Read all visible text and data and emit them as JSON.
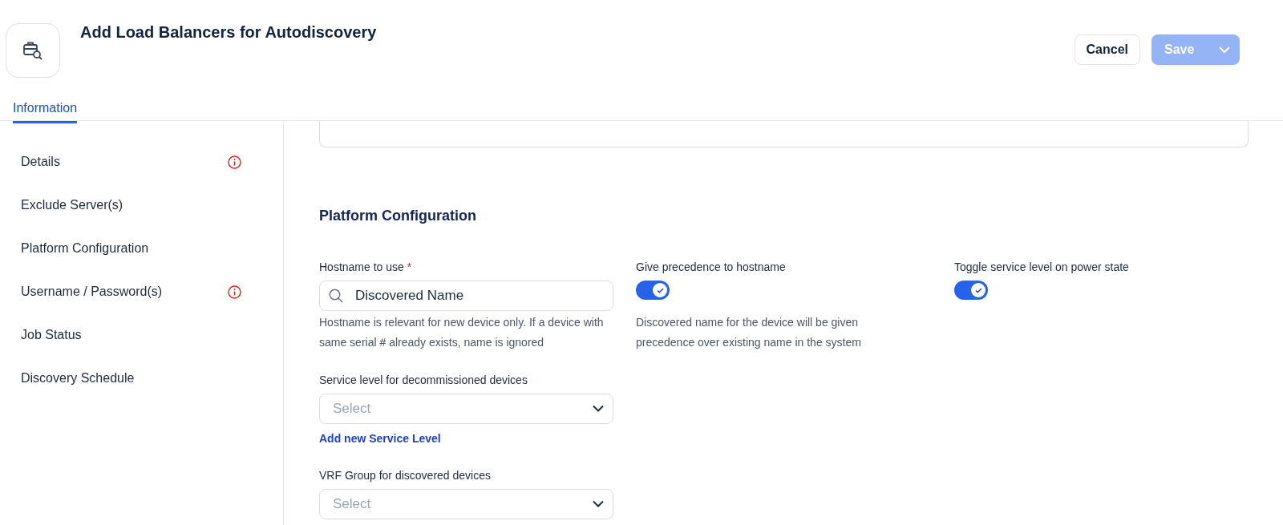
{
  "header": {
    "title": "Add Load Balancers for Autodiscovery",
    "buttons": [
      {
        "label": "Cancel",
        "kind": "secondary",
        "disabled": false
      },
      {
        "label": "Save",
        "kind": "primary",
        "disabled": true
      }
    ]
  },
  "tabs": [
    {
      "label": "Information",
      "selected": true
    }
  ],
  "sidebar": {
    "items": [
      {
        "label": "Details",
        "warning": true
      },
      {
        "label": "Exclude Server(s)",
        "warning": false
      },
      {
        "label": "Platform Configuration",
        "warning": false
      },
      {
        "label": "Username / Password(s)",
        "warning": true
      },
      {
        "label": "Job Status",
        "warning": false
      },
      {
        "label": "Discovery Schedule",
        "warning": false
      }
    ]
  },
  "section": {
    "title": "Platform Configuration",
    "hostname": {
      "label": "Hostname to use",
      "required_mark": "*",
      "value": "Discovered Name",
      "help": "Hostname is relevant for new device only. If a device with same serial # already exists, name is ignored"
    },
    "service_level": {
      "label": "Service level for decommissioned devices",
      "placeholder": "Select",
      "link": "Add new Service Level"
    },
    "vrf_group": {
      "label": "VRF Group for discovered devices",
      "placeholder": "Select"
    },
    "toggles": [
      {
        "label": "Give precedence to hostname",
        "on": true,
        "help": "Discovered name for the device will be given precedence over existing name in the system"
      },
      {
        "label": "Toggle service level on power state",
        "on": true
      }
    ]
  }
}
